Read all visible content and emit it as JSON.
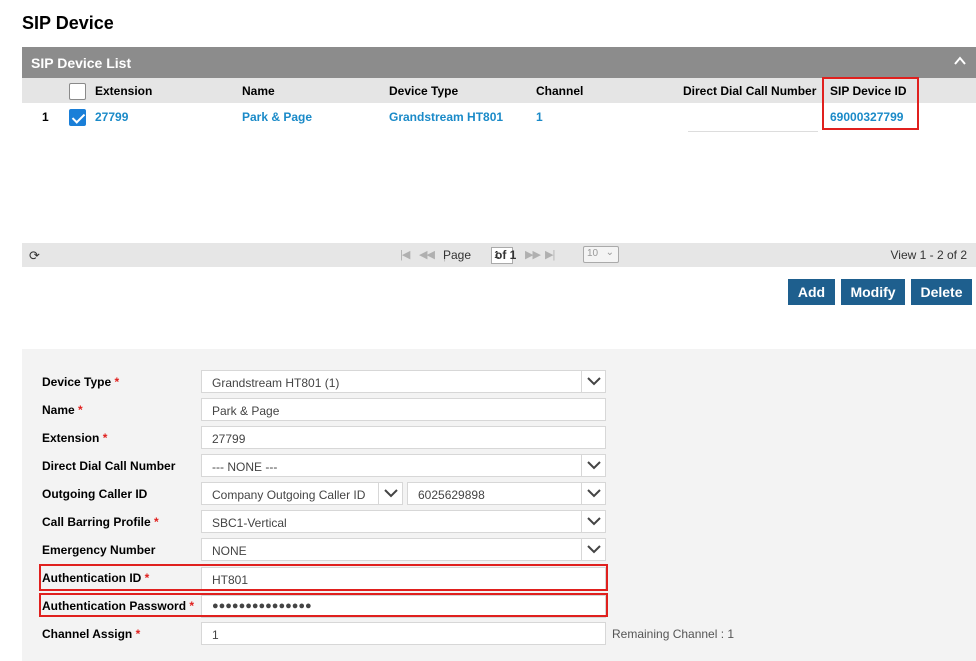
{
  "page_title": "SIP Device",
  "grid": {
    "title": "SIP Device List",
    "columns": {
      "extension": "Extension",
      "name": "Name",
      "device_type": "Device Type",
      "channel": "Channel",
      "direct_dial": "Direct Dial Call Number",
      "sip_device_id": "SIP Device ID"
    },
    "rows": [
      {
        "index": "1",
        "checked": true,
        "extension": "27799",
        "name": "Park & Page",
        "device_type": "Grandstream HT801",
        "channel": "1",
        "direct_dial": "",
        "sip_device_id": "69000327799"
      }
    ]
  },
  "pager": {
    "page_label": "Page",
    "page_value": "1",
    "of_label": "of 1",
    "rows_per_page": "10",
    "view_text": "View 1 - 2 of 2"
  },
  "buttons": {
    "add": "Add",
    "modify": "Modify",
    "delete": "Delete"
  },
  "form": {
    "required_mark": "*",
    "device_type": {
      "label": "Device Type",
      "value": "Grandstream HT801 (1)"
    },
    "name": {
      "label": "Name",
      "value": "Park & Page"
    },
    "extension": {
      "label": "Extension",
      "value": "27799"
    },
    "direct_dial": {
      "label": "Direct Dial Call Number",
      "value": "--- NONE ---"
    },
    "outgoing_caller_id": {
      "label": "Outgoing Caller ID",
      "type_value": "Company Outgoing Caller ID",
      "number_value": "6025629898"
    },
    "call_barring": {
      "label": "Call Barring Profile",
      "value": "SBC1-Vertical"
    },
    "emergency_number": {
      "label": "Emergency Number",
      "value": "NONE"
    },
    "auth_id": {
      "label": "Authentication ID",
      "value": "HT801"
    },
    "auth_password": {
      "label": "Authentication Password",
      "value": "●●●●●●●●●●●●●●●"
    },
    "channel_assign": {
      "label": "Channel Assign",
      "value": "1",
      "remaining": "Remaining Channel : 1"
    }
  },
  "colors": {
    "accent": "#1e5f8e",
    "link": "#1a8ac8",
    "highlight": "#e0201e",
    "header": "#8c8c8c"
  }
}
